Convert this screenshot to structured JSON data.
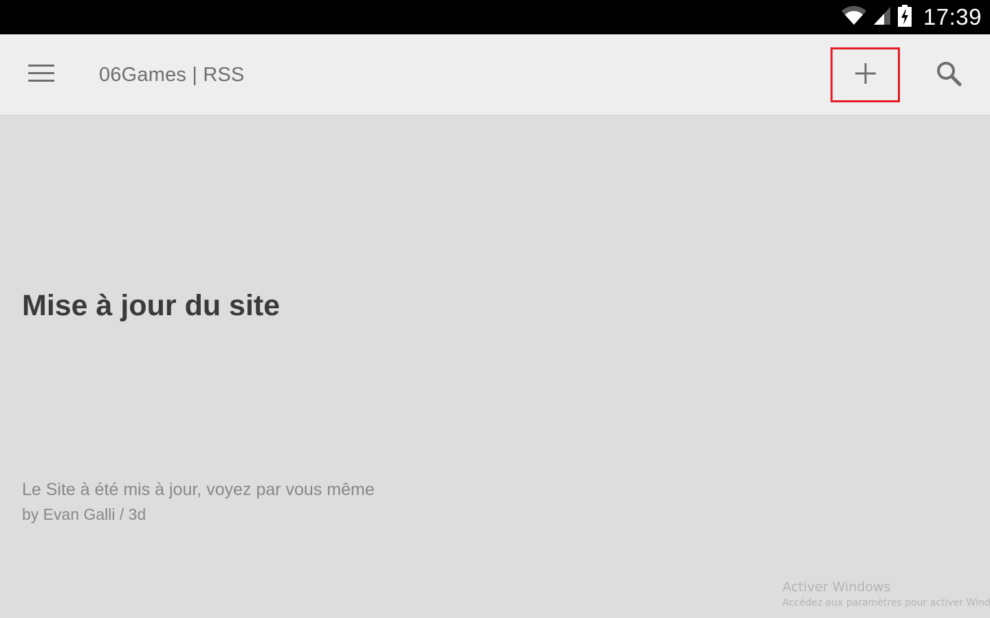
{
  "status_bar": {
    "time": "17:39",
    "icons": [
      "wifi-icon",
      "signal-icon",
      "battery-charging-icon"
    ]
  },
  "app_bar": {
    "menu_icon": "hamburger-menu-icon",
    "title": "06Games | RSS",
    "add_icon": "plus-icon",
    "search_icon": "search-icon",
    "highlight_color": "#e51c23"
  },
  "article": {
    "title": "Mise à jour du site",
    "summary": "Le Site à été mis à jour, voyez par vous même",
    "meta": "by Evan Galli / 3d"
  },
  "watermark": {
    "title": "Activer Windows",
    "subtitle": "Accédez aux paramètres pour activer Windows."
  },
  "colors": {
    "status_bar_bg": "#000000",
    "app_bar_bg": "#eeeeee",
    "content_bg": "#dddddd",
    "icon_color": "#6e6e6e"
  }
}
